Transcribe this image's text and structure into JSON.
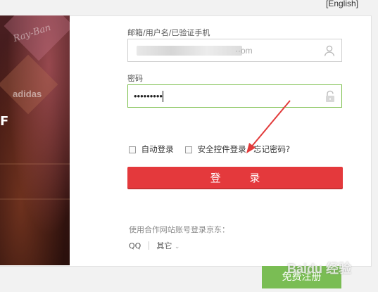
{
  "header": {
    "english_link": "[English]"
  },
  "banner": {
    "brand_top": "Ray-Ban",
    "brand_mid": "adidas",
    "mark": "F"
  },
  "username": {
    "label": "邮箱/用户名/已验证手机",
    "value_suffix": "··om"
  },
  "password": {
    "label": "密码",
    "masked_value": "•••••••••"
  },
  "options": {
    "auto_login": "自动登录",
    "secure_login": "安全控件登录",
    "forgot_password": "忘记密码?"
  },
  "login_button": "登 录",
  "partners": {
    "label": "使用合作网站账号登录京东：",
    "qq": "QQ",
    "other": "其它"
  },
  "register_button": "免费注册",
  "watermark": "Baidu 经验",
  "colors": {
    "primary_red": "#e4393c",
    "register_green": "#7abd54",
    "focus_border": "#7cbf4c"
  }
}
